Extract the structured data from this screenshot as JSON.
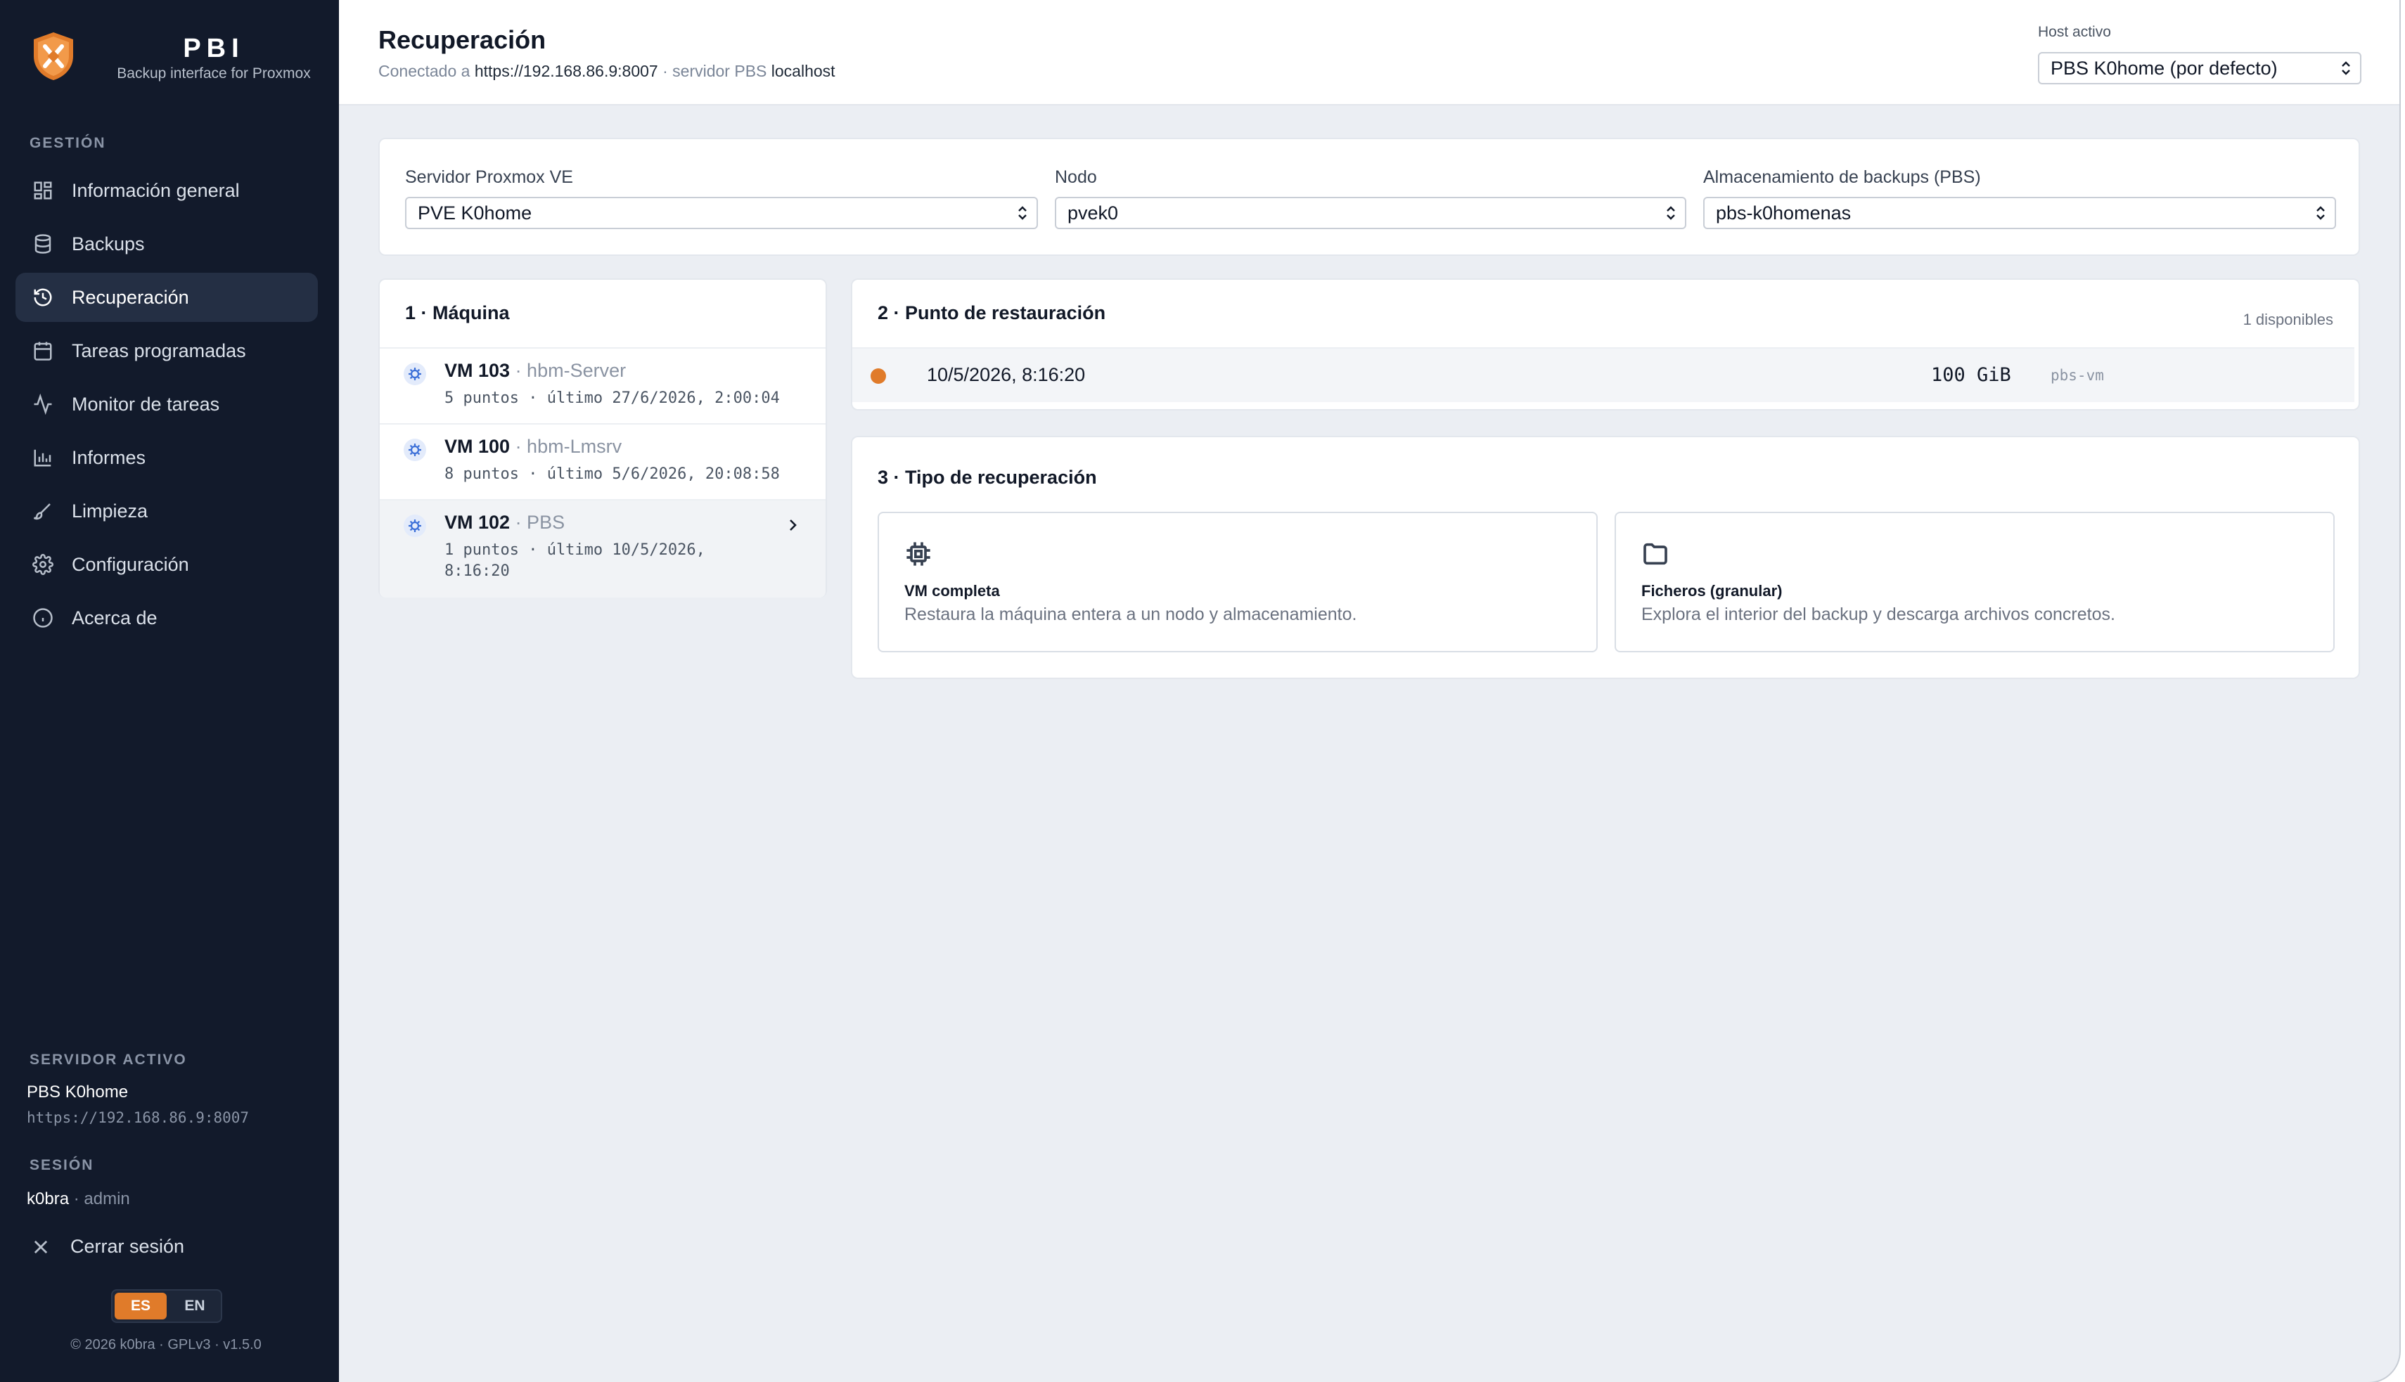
{
  "brand": {
    "title": "PBI",
    "subtitle": "Backup interface for Proxmox"
  },
  "sidebar": {
    "section_label": "GESTIÓN",
    "items": [
      {
        "label": "Información general",
        "icon": "grid-icon"
      },
      {
        "label": "Backups",
        "icon": "database-icon"
      },
      {
        "label": "Recuperación",
        "icon": "history-icon",
        "active": true
      },
      {
        "label": "Tareas programadas",
        "icon": "calendar-icon"
      },
      {
        "label": "Monitor de tareas",
        "icon": "activity-icon"
      },
      {
        "label": "Informes",
        "icon": "bar-chart-icon"
      },
      {
        "label": "Limpieza",
        "icon": "brush-icon"
      },
      {
        "label": "Configuración",
        "icon": "gear-icon"
      },
      {
        "label": "Acerca de",
        "icon": "info-icon"
      }
    ],
    "active_server_label": "SERVIDOR ACTIVO",
    "active_server_name": "PBS K0home",
    "active_server_url": "https://192.168.86.9:8007",
    "session_label": "SESIÓN",
    "session_user": "k0bra",
    "session_role": " · admin",
    "logout": "Cerrar sesión",
    "lang_es": "ES",
    "lang_en": "EN",
    "footer": "© 2026 k0bra · GPLv3 · v1.5.0"
  },
  "header": {
    "title": "Recuperación",
    "conn_prefix": "Conectado a ",
    "conn_url": "https://192.168.86.9:8007",
    "conn_mid": " · servidor PBS ",
    "conn_host": "localhost",
    "host_label": "Host activo",
    "host_value": "PBS K0home (por defecto)"
  },
  "filters": {
    "pve_label": "Servidor Proxmox VE",
    "pve_value": "PVE K0home",
    "node_label": "Nodo",
    "node_value": "pvek0",
    "storage_label": "Almacenamiento de backups (PBS)",
    "storage_value": "pbs-k0homenas"
  },
  "machines": {
    "title": "1 · Máquina",
    "items": [
      {
        "id": "VM 103",
        "name": " · hbm-Server",
        "meta": "5 puntos · último 27/6/2026, 2:00:04"
      },
      {
        "id": "VM 100",
        "name": " · hbm-Lmsrv",
        "meta": "8 puntos · último 5/6/2026, 20:08:58"
      },
      {
        "id": "VM 102",
        "name": " · PBS",
        "meta": "1 puntos · último 10/5/2026, 8:16:20",
        "selected": true
      }
    ]
  },
  "restore_points": {
    "title": "2 · Punto de restauración",
    "available": "1 disponibles",
    "items": [
      {
        "date": "10/5/2026, 8:16:20",
        "size": "100 GiB",
        "store": "pbs-vm"
      }
    ]
  },
  "recovery_type": {
    "title": "3 · Tipo de recuperación",
    "options": [
      {
        "title": "VM completa",
        "desc": "Restaura la máquina entera a un nodo y almacenamiento.",
        "icon": "cpu-icon"
      },
      {
        "title": "Ficheros (granular)",
        "desc": "Explora el interior del backup y descarga archivos concretos.",
        "icon": "folder-icon"
      }
    ]
  },
  "colors": {
    "accent": "#e07b2a",
    "sidebar_bg": "#121a2b",
    "content_bg": "#ebeef3"
  }
}
